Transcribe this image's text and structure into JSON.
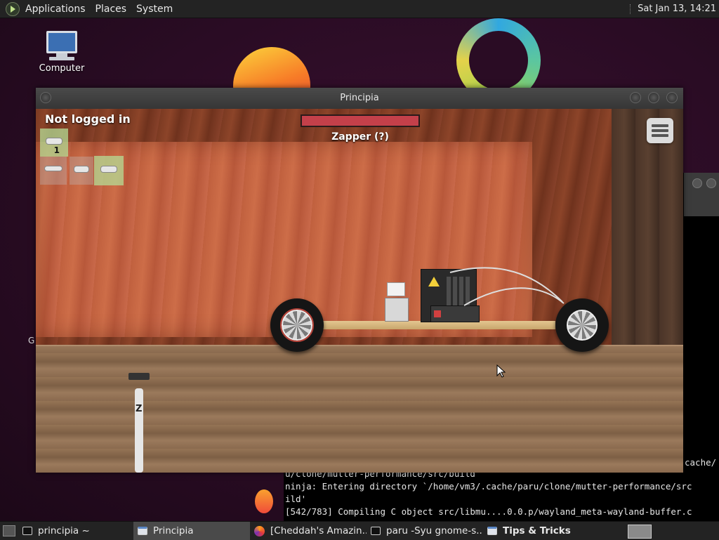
{
  "top_panel": {
    "menus": [
      "Applications",
      "Places",
      "System"
    ],
    "clock": "Sat Jan 13, 14:21"
  },
  "desktop": {
    "icons": [
      {
        "label": "Computer"
      }
    ],
    "stray_letter": "G"
  },
  "terminal": {
    "lines": [
      "u/clone/mutter-performance/src/build",
      "ninja: Entering directory `/home/vm3/.cache/paru/clone/mutter-performance/src",
      "ild'",
      "[542/783] Compiling C object src/libmu....0.0.p/wayland_meta-wayland-buffer.c"
    ],
    "right_fragment": "cache/"
  },
  "principia": {
    "title": "Principia",
    "login_status": "Not logged in",
    "tool_name": "Zapper (?)",
    "health_fraction": 1.0,
    "tools": [
      {
        "name": "zapper-tool",
        "count": "1",
        "active": true
      },
      {
        "name": "wrench-tool",
        "active": false
      },
      {
        "name": "pointer-tool",
        "active": false
      },
      {
        "name": "grabber-tool",
        "active": true
      }
    ],
    "zoom_label": "Z"
  },
  "taskbar": {
    "items": [
      {
        "label": "principia ~",
        "icon": "terminal-icon",
        "active": false
      },
      {
        "label": "Principia",
        "icon": "window-icon",
        "active": true
      },
      {
        "label": "[Cheddah's Amazin...",
        "icon": "firefox-icon",
        "active": false
      },
      {
        "label": "paru -Syu gnome-s...",
        "icon": "terminal-icon",
        "active": false
      },
      {
        "label": "Tips & Tricks",
        "icon": "window-icon",
        "active": false
      }
    ]
  },
  "colors": {
    "health_bar": "#c4404a",
    "desktop_bg": "#2a0c24",
    "panel_bg": "#232323"
  }
}
